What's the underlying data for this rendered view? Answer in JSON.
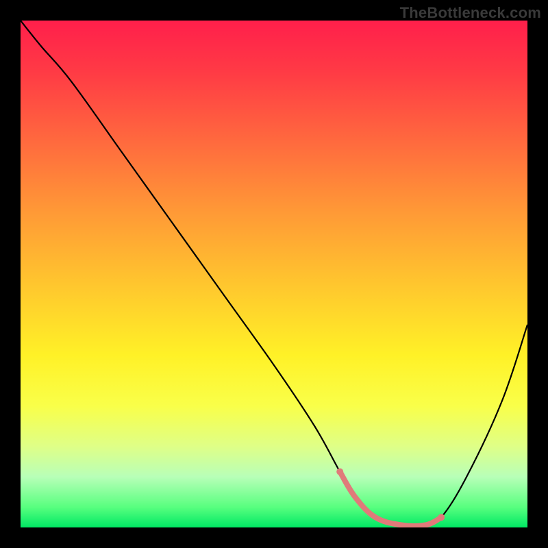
{
  "watermark": "TheBottleneck.com",
  "chart_data": {
    "type": "line",
    "title": "",
    "xlabel": "",
    "ylabel": "",
    "xlim": [
      0,
      100
    ],
    "ylim": [
      0,
      100
    ],
    "grid": false,
    "series": [
      {
        "name": "bottleneck-curve",
        "x": [
          0,
          4,
          10,
          20,
          30,
          40,
          50,
          58,
          63,
          66,
          70,
          75,
          80,
          83,
          88,
          95,
          100
        ],
        "y": [
          100,
          95,
          88,
          74,
          60,
          46,
          32,
          20,
          11,
          6,
          2,
          0.5,
          0.5,
          2,
          10,
          25,
          40
        ],
        "color": "#000000"
      },
      {
        "name": "operating-range-highlight",
        "x": [
          63,
          66,
          70,
          75,
          80,
          83
        ],
        "y": [
          11,
          6,
          2,
          0.5,
          0.5,
          2
        ],
        "color": "#e07a7a"
      }
    ],
    "annotations": []
  },
  "colors": {
    "background": "#000000",
    "gradient_top": "#ff1f4b",
    "gradient_bottom": "#00e864",
    "curve": "#000000",
    "highlight": "#e07a7a",
    "watermark": "#3a3a3a"
  }
}
